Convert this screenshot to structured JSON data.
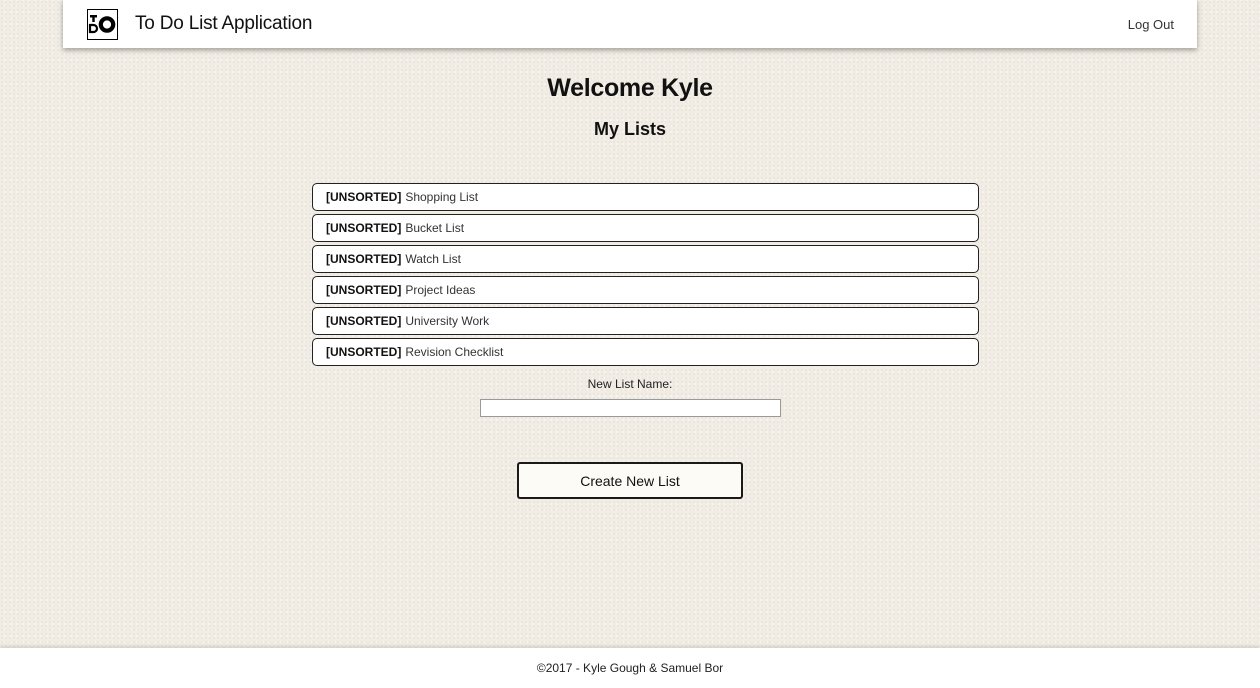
{
  "navbar": {
    "logo_icon": "todo-logo-icon",
    "title": "To Do List Application",
    "logout_label": "Log Out"
  },
  "main": {
    "welcome": "Welcome Kyle",
    "subtitle": "My Lists",
    "lists": [
      {
        "tag": "[UNSORTED]",
        "name": "Shopping List"
      },
      {
        "tag": "[UNSORTED]",
        "name": "Bucket List"
      },
      {
        "tag": "[UNSORTED]",
        "name": "Watch List"
      },
      {
        "tag": "[UNSORTED]",
        "name": "Project Ideas"
      },
      {
        "tag": "[UNSORTED]",
        "name": "University Work"
      },
      {
        "tag": "[UNSORTED]",
        "name": "Revision Checklist"
      }
    ],
    "new_list": {
      "label": "New List Name:",
      "value": "",
      "button_label": "Create New List"
    }
  },
  "footer": {
    "copyright": "©2017 - Kyle Gough & Samuel Bor"
  },
  "colors": {
    "background": "#f1ede4",
    "surface": "#ffffff",
    "border": "#222222"
  }
}
